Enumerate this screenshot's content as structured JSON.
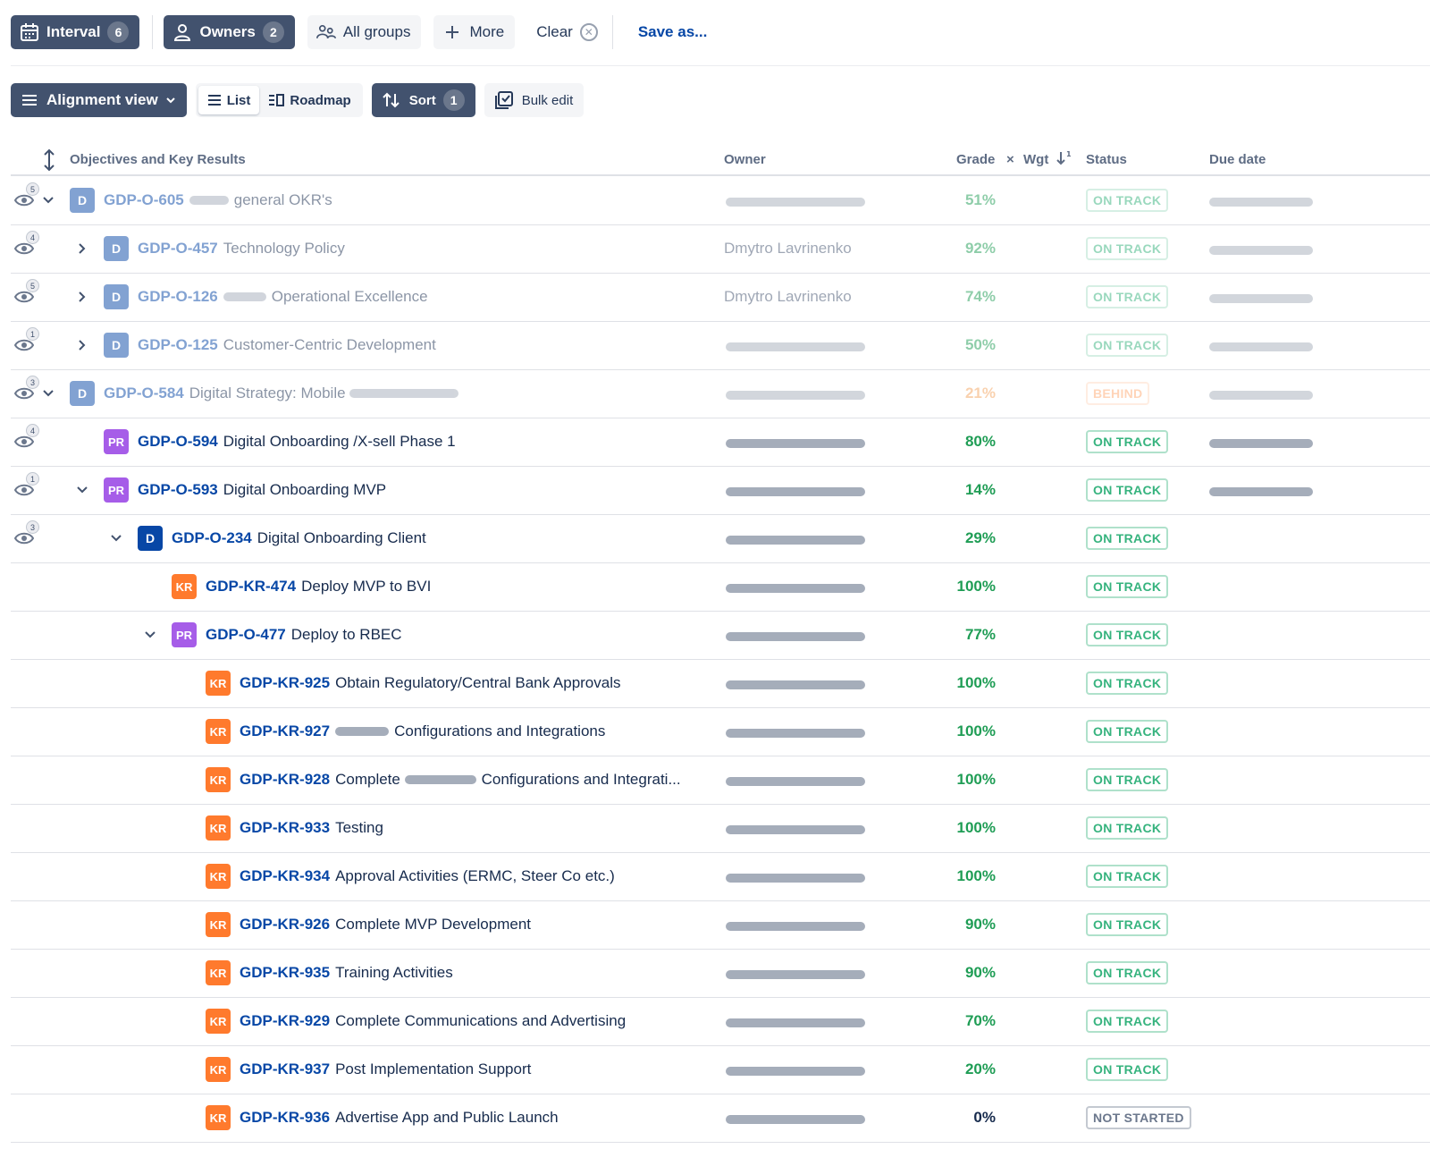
{
  "filters": {
    "interval_label": "Interval",
    "interval_count": "6",
    "owners_label": "Owners",
    "owners_count": "2",
    "all_groups_label": "All groups",
    "more_label": "More",
    "clear_label": "Clear",
    "save_as_label": "Save as..."
  },
  "toolbar": {
    "view_label": "Alignment view",
    "list_label": "List",
    "roadmap_label": "Roadmap",
    "sort_label": "Sort",
    "sort_count": "1",
    "bulk_edit_label": "Bulk edit"
  },
  "table": {
    "headers": {
      "objectives": "Objectives and Key Results",
      "owner": "Owner",
      "grade": "Grade",
      "times": "×",
      "weight": "Wgt",
      "status": "Status",
      "due_date": "Due date"
    },
    "rows": [
      {
        "eye_count": "5",
        "chevron": "down",
        "indent": 0,
        "type": "D",
        "key": "GDP-O-605",
        "pre_redact": 44,
        "title": "general OKR's",
        "post_redact": 0,
        "owner": "",
        "owner_redacted": true,
        "grade": "51%",
        "status": "ON TRACK",
        "due_redacted": true,
        "faded": true
      },
      {
        "eye_count": "4",
        "chevron": "right",
        "indent": 1,
        "type": "D",
        "key": "GDP-O-457",
        "pre_redact": 0,
        "title": "Technology Policy",
        "post_redact": 0,
        "owner": "Dmytro Lavrinenko",
        "owner_redacted": false,
        "grade": "92%",
        "status": "ON TRACK",
        "due_redacted": true,
        "faded": true
      },
      {
        "eye_count": "5",
        "chevron": "right",
        "indent": 1,
        "type": "D",
        "key": "GDP-O-126",
        "pre_redact": 48,
        "title": "Operational Excellence",
        "post_redact": 0,
        "owner": "Dmytro Lavrinenko",
        "owner_redacted": false,
        "grade": "74%",
        "status": "ON TRACK",
        "due_redacted": true,
        "faded": true
      },
      {
        "eye_count": "1",
        "chevron": "right",
        "indent": 1,
        "type": "D",
        "key": "GDP-O-125",
        "pre_redact": 0,
        "title": "Customer-Centric Development",
        "post_redact": 0,
        "owner": "",
        "owner_redacted": true,
        "grade": "50%",
        "status": "ON TRACK",
        "due_redacted": true,
        "faded": true
      },
      {
        "eye_count": "3",
        "chevron": "down",
        "indent": 0,
        "type": "D",
        "key": "GDP-O-584",
        "pre_redact": 0,
        "title": "Digital Strategy: Mobile",
        "post_redact": 122,
        "owner": "",
        "owner_redacted": true,
        "grade": "21%",
        "status": "BEHIND",
        "due_redacted": true,
        "faded": true
      },
      {
        "eye_count": "4",
        "chevron": "",
        "indent": 1,
        "type": "PR",
        "key": "GDP-O-594",
        "pre_redact": 0,
        "title": "Digital Onboarding /X-sell Phase 1",
        "post_redact": 0,
        "owner": "",
        "owner_redacted": true,
        "grade": "80%",
        "status": "ON TRACK",
        "due_redacted": true,
        "faded": false
      },
      {
        "eye_count": "1",
        "chevron": "down",
        "indent": 1,
        "type": "PR",
        "key": "GDP-O-593",
        "pre_redact": 0,
        "title": "Digital Onboarding MVP",
        "post_redact": 0,
        "owner": "",
        "owner_redacted": true,
        "grade": "14%",
        "status": "ON TRACK",
        "due_redacted": true,
        "faded": false
      },
      {
        "eye_count": "3",
        "chevron": "down",
        "indent": 2,
        "type": "D",
        "key": "GDP-O-234",
        "pre_redact": 0,
        "title": "Digital Onboarding Client",
        "post_redact": 0,
        "owner": "",
        "owner_redacted": true,
        "grade": "29%",
        "status": "ON TRACK",
        "due_redacted": false,
        "faded": false
      },
      {
        "eye_count": "",
        "chevron": "",
        "indent": 3,
        "type": "KR",
        "key": "GDP-KR-474",
        "pre_redact": 0,
        "title": "Deploy MVP to BVI",
        "post_redact": 0,
        "owner": "",
        "owner_redacted": true,
        "grade": "100%",
        "status": "ON TRACK",
        "due_redacted": false,
        "faded": false
      },
      {
        "eye_count": "",
        "chevron": "down",
        "indent": 3,
        "type": "PR",
        "key": "GDP-O-477",
        "pre_redact": 0,
        "title": "Deploy to RBEC",
        "post_redact": 0,
        "owner": "",
        "owner_redacted": true,
        "grade": "77%",
        "status": "ON TRACK",
        "due_redacted": false,
        "faded": false
      },
      {
        "eye_count": "",
        "chevron": "",
        "indent": 4,
        "type": "KR",
        "key": "GDP-KR-925",
        "pre_redact": 0,
        "title": "Obtain Regulatory/Central Bank Approvals",
        "post_redact": 0,
        "owner": "",
        "owner_redacted": true,
        "grade": "100%",
        "status": "ON TRACK",
        "due_redacted": false,
        "faded": false
      },
      {
        "eye_count": "",
        "chevron": "",
        "indent": 4,
        "type": "KR",
        "key": "GDP-KR-927",
        "pre_redact": 60,
        "title": "Configurations and Integrations",
        "post_redact": 0,
        "owner": "",
        "owner_redacted": true,
        "grade": "100%",
        "status": "ON TRACK",
        "due_redacted": false,
        "faded": false
      },
      {
        "eye_count": "",
        "chevron": "",
        "indent": 4,
        "type": "KR",
        "key": "GDP-KR-928",
        "pre_redact": 0,
        "title": "Complete",
        "post_redact": 0,
        "mid_redact": 80,
        "title2": "Configurations and Integrati...",
        "owner": "",
        "owner_redacted": true,
        "grade": "100%",
        "status": "ON TRACK",
        "due_redacted": false,
        "faded": false
      },
      {
        "eye_count": "",
        "chevron": "",
        "indent": 4,
        "type": "KR",
        "key": "GDP-KR-933",
        "pre_redact": 0,
        "title": "Testing",
        "post_redact": 0,
        "owner": "",
        "owner_redacted": true,
        "grade": "100%",
        "status": "ON TRACK",
        "due_redacted": false,
        "faded": false
      },
      {
        "eye_count": "",
        "chevron": "",
        "indent": 4,
        "type": "KR",
        "key": "GDP-KR-934",
        "pre_redact": 0,
        "title": "Approval Activities (ERMC, Steer Co etc.)",
        "post_redact": 0,
        "owner": "",
        "owner_redacted": true,
        "grade": "100%",
        "status": "ON TRACK",
        "due_redacted": false,
        "faded": false
      },
      {
        "eye_count": "",
        "chevron": "",
        "indent": 4,
        "type": "KR",
        "key": "GDP-KR-926",
        "pre_redact": 0,
        "title": "Complete MVP Development",
        "post_redact": 0,
        "owner": "",
        "owner_redacted": true,
        "grade": "90%",
        "status": "ON TRACK",
        "due_redacted": false,
        "faded": false
      },
      {
        "eye_count": "",
        "chevron": "",
        "indent": 4,
        "type": "KR",
        "key": "GDP-KR-935",
        "pre_redact": 0,
        "title": "Training Activities",
        "post_redact": 0,
        "owner": "",
        "owner_redacted": true,
        "grade": "90%",
        "status": "ON TRACK",
        "due_redacted": false,
        "faded": false
      },
      {
        "eye_count": "",
        "chevron": "",
        "indent": 4,
        "type": "KR",
        "key": "GDP-KR-929",
        "pre_redact": 0,
        "title": "Complete Communications and Advertising",
        "post_redact": 0,
        "owner": "",
        "owner_redacted": true,
        "grade": "70%",
        "status": "ON TRACK",
        "due_redacted": false,
        "faded": false
      },
      {
        "eye_count": "",
        "chevron": "",
        "indent": 4,
        "type": "KR",
        "key": "GDP-KR-937",
        "pre_redact": 0,
        "title": "Post Implementation Support",
        "post_redact": 0,
        "owner": "",
        "owner_redacted": true,
        "grade": "20%",
        "status": "ON TRACK",
        "due_redacted": false,
        "faded": false
      },
      {
        "eye_count": "",
        "chevron": "",
        "indent": 4,
        "type": "KR",
        "key": "GDP-KR-936",
        "pre_redact": 0,
        "title": "Advertise App and Public Launch",
        "post_redact": 0,
        "owner": "",
        "owner_redacted": true,
        "grade": "0%",
        "status": "NOT STARTED",
        "due_redacted": false,
        "faded": false
      }
    ]
  },
  "colors": {
    "grade_green": "#1f9d55",
    "grade_orange": "#f5a45f",
    "grade_zero": "#172b4d",
    "status_on_track": "#36b37e",
    "status_behind": "#ffab73",
    "status_not_started": "#6b778c"
  },
  "icons": {
    "interval": "calendar-icon",
    "owners": "person-icon",
    "groups": "people-icon",
    "more": "plus-icon",
    "clear": "close-circle-icon",
    "view": "menu-icon",
    "list": "list-icon",
    "roadmap": "roadmap-icon",
    "sort": "sort-arrows-icon",
    "bulk": "checkbox-icon",
    "row_visibility": "eye-icon"
  }
}
